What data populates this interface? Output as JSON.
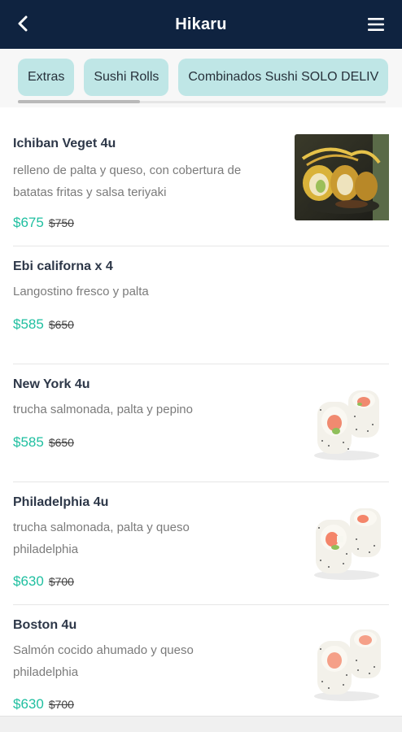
{
  "header": {
    "title": "Hikaru",
    "back_icon": "chevron-left-icon",
    "menu_icon": "hamburger-menu-icon"
  },
  "categories": [
    {
      "label": "Extras"
    },
    {
      "label": "Sushi Rolls"
    },
    {
      "label": "Combinados Sushi SOLO DELIV"
    }
  ],
  "products": [
    {
      "name": "Ichiban Veget 4u",
      "desc_line1": "relleno de palta y queso, con cobertura de",
      "desc_line2": "batatas fritas y salsa teriyaki",
      "price": "$675",
      "old_price": "$750",
      "image": "sushi-photo"
    },
    {
      "name": "Ebi californa x 4",
      "desc_line1": "Langostino fresco y palta",
      "desc_line2": "",
      "price": "$585",
      "old_price": "$650",
      "image": ""
    },
    {
      "name": "New York 4u",
      "desc_line1": "trucha salmonada, palta y pepino",
      "desc_line2": "",
      "price": "$585",
      "old_price": "$650",
      "image": "sushi-photo"
    },
    {
      "name": "Philadelphia 4u",
      "desc_line1": "trucha salmonada, palta y queso",
      "desc_line2": "philadelphia",
      "price": "$630",
      "old_price": "$700",
      "image": "sushi-photo"
    },
    {
      "name": "Boston 4u",
      "desc_line1": "Salmón cocido ahumado y queso",
      "desc_line2": "philadelphia",
      "price": "$630",
      "old_price": "$700",
      "image": "sushi-photo"
    }
  ],
  "colors": {
    "header_bg": "#0f2340",
    "chip_bg": "#bfe6e6",
    "price": "#1fbfa0"
  }
}
